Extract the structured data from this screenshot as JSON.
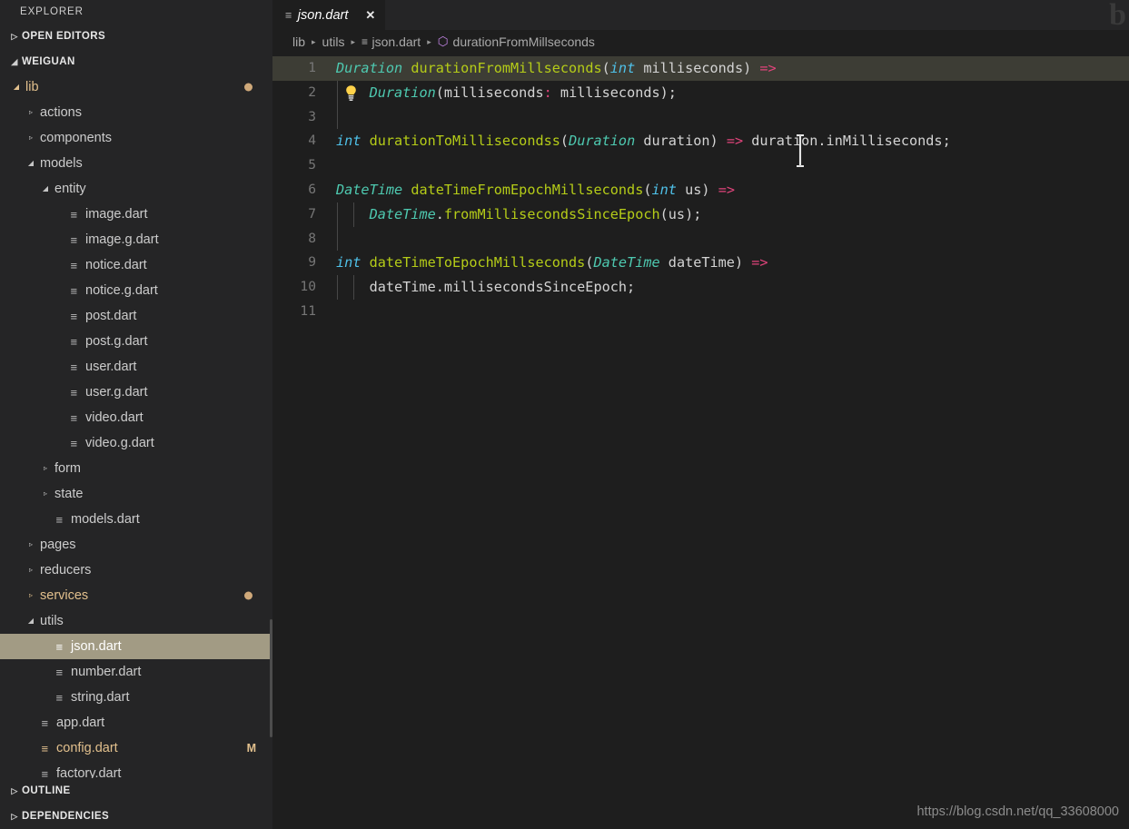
{
  "sidebar": {
    "title": "EXPLORER",
    "panes": [
      {
        "label": "OPEN EDITORS",
        "expanded": false
      },
      {
        "label": "WEIGUAN",
        "expanded": true
      }
    ],
    "bottom_panes": [
      {
        "label": "OUTLINE",
        "expanded": false
      },
      {
        "label": "DEPENDENCIES",
        "expanded": false
      }
    ],
    "tree": [
      {
        "label": "lib",
        "type": "folder",
        "indent": 1,
        "expanded": true,
        "modified": true,
        "dot": true
      },
      {
        "label": "actions",
        "type": "folder",
        "indent": 2,
        "expanded": false
      },
      {
        "label": "components",
        "type": "folder",
        "indent": 2,
        "expanded": false
      },
      {
        "label": "models",
        "type": "folder",
        "indent": 2,
        "expanded": true
      },
      {
        "label": "entity",
        "type": "folder",
        "indent": 3,
        "expanded": true
      },
      {
        "label": "image.dart",
        "type": "file",
        "indent": 4
      },
      {
        "label": "image.g.dart",
        "type": "file",
        "indent": 4
      },
      {
        "label": "notice.dart",
        "type": "file",
        "indent": 4
      },
      {
        "label": "notice.g.dart",
        "type": "file",
        "indent": 4
      },
      {
        "label": "post.dart",
        "type": "file",
        "indent": 4
      },
      {
        "label": "post.g.dart",
        "type": "file",
        "indent": 4
      },
      {
        "label": "user.dart",
        "type": "file",
        "indent": 4
      },
      {
        "label": "user.g.dart",
        "type": "file",
        "indent": 4
      },
      {
        "label": "video.dart",
        "type": "file",
        "indent": 4
      },
      {
        "label": "video.g.dart",
        "type": "file",
        "indent": 4
      },
      {
        "label": "form",
        "type": "folder",
        "indent": 3,
        "expanded": false
      },
      {
        "label": "state",
        "type": "folder",
        "indent": 3,
        "expanded": false
      },
      {
        "label": "models.dart",
        "type": "file",
        "indent": 3
      },
      {
        "label": "pages",
        "type": "folder",
        "indent": 2,
        "expanded": false
      },
      {
        "label": "reducers",
        "type": "folder",
        "indent": 2,
        "expanded": false
      },
      {
        "label": "services",
        "type": "folder",
        "indent": 2,
        "expanded": false,
        "modified": true,
        "dot": true
      },
      {
        "label": "utils",
        "type": "folder",
        "indent": 2,
        "expanded": true
      },
      {
        "label": "json.dart",
        "type": "file",
        "indent": 3,
        "selected": true
      },
      {
        "label": "number.dart",
        "type": "file",
        "indent": 3
      },
      {
        "label": "string.dart",
        "type": "file",
        "indent": 3
      },
      {
        "label": "app.dart",
        "type": "file",
        "indent": 2
      },
      {
        "label": "config.dart",
        "type": "file",
        "indent": 2,
        "modified": true,
        "badge": "M"
      },
      {
        "label": "factory.dart",
        "type": "file",
        "indent": 2
      }
    ]
  },
  "tab": {
    "name": "json.dart",
    "icon": "file-icon",
    "close": "✕",
    "preview": true
  },
  "breadcrumb": [
    {
      "text": "lib",
      "icon": null
    },
    {
      "text": "utils",
      "icon": null
    },
    {
      "text": "json.dart",
      "icon": "file-icon"
    },
    {
      "text": "durationFromMillseconds",
      "icon": "symbol-cube-icon"
    }
  ],
  "editor": {
    "active_line": 1,
    "quickfix_line": 2,
    "quickfix_icon": "lightbulb-icon",
    "lines": [
      {
        "n": 1,
        "active": true,
        "indent_guides": 0,
        "tokens": [
          {
            "t": "Duration",
            "c": "type"
          },
          {
            "t": " ",
            "c": "plain"
          },
          {
            "t": "durationFromMillseconds",
            "c": "fn"
          },
          {
            "t": "(",
            "c": "punct"
          },
          {
            "t": "int",
            "c": "kw"
          },
          {
            "t": " milliseconds",
            "c": "plain"
          },
          {
            "t": ")",
            "c": "punct"
          },
          {
            "t": " ",
            "c": "plain"
          },
          {
            "t": "=>",
            "c": "arrow"
          }
        ]
      },
      {
        "n": 2,
        "active": false,
        "indent_guides": 1,
        "tokens": [
          {
            "t": "    ",
            "c": "plain"
          },
          {
            "t": "Duration",
            "c": "type"
          },
          {
            "t": "(",
            "c": "punct"
          },
          {
            "t": "milliseconds",
            "c": "plain"
          },
          {
            "t": ":",
            "c": "colon"
          },
          {
            "t": " milliseconds",
            "c": "plain"
          },
          {
            "t": ");",
            "c": "punct"
          }
        ]
      },
      {
        "n": 3,
        "active": false,
        "indent_guides": 1,
        "tokens": []
      },
      {
        "n": 4,
        "active": false,
        "indent_guides": 0,
        "tokens": [
          {
            "t": "int",
            "c": "kw"
          },
          {
            "t": " ",
            "c": "plain"
          },
          {
            "t": "durationToMillisecondss",
            "c": "fn"
          },
          {
            "t": "(",
            "c": "punct"
          },
          {
            "t": "Duration",
            "c": "type"
          },
          {
            "t": " duration",
            "c": "plain"
          },
          {
            "t": ")",
            "c": "punct"
          },
          {
            "t": " ",
            "c": "plain"
          },
          {
            "t": "=>",
            "c": "arrow"
          },
          {
            "t": " duration.inMilliseconds;",
            "c": "plain"
          }
        ]
      },
      {
        "n": 5,
        "active": false,
        "indent_guides": 0,
        "tokens": []
      },
      {
        "n": 6,
        "active": false,
        "indent_guides": 0,
        "tokens": [
          {
            "t": "DateTime",
            "c": "type"
          },
          {
            "t": " ",
            "c": "plain"
          },
          {
            "t": "dateTimeFromEpochMillseconds",
            "c": "fn"
          },
          {
            "t": "(",
            "c": "punct"
          },
          {
            "t": "int",
            "c": "kw"
          },
          {
            "t": " us",
            "c": "plain"
          },
          {
            "t": ")",
            "c": "punct"
          },
          {
            "t": " ",
            "c": "plain"
          },
          {
            "t": "=>",
            "c": "arrow"
          }
        ]
      },
      {
        "n": 7,
        "active": false,
        "indent_guides": 2,
        "tokens": [
          {
            "t": "    ",
            "c": "plain"
          },
          {
            "t": "DateTime",
            "c": "type"
          },
          {
            "t": ".",
            "c": "punct"
          },
          {
            "t": "fromMillisecondsSinceEpoch",
            "c": "fn"
          },
          {
            "t": "(us);",
            "c": "plain"
          }
        ]
      },
      {
        "n": 8,
        "active": false,
        "indent_guides": 1,
        "tokens": []
      },
      {
        "n": 9,
        "active": false,
        "indent_guides": 0,
        "tokens": [
          {
            "t": "int",
            "c": "kw"
          },
          {
            "t": " ",
            "c": "plain"
          },
          {
            "t": "dateTimeToEpochMillseconds",
            "c": "fn"
          },
          {
            "t": "(",
            "c": "punct"
          },
          {
            "t": "DateTime",
            "c": "type"
          },
          {
            "t": " dateTime",
            "c": "plain"
          },
          {
            "t": ")",
            "c": "punct"
          },
          {
            "t": " ",
            "c": "plain"
          },
          {
            "t": "=>",
            "c": "arrow"
          }
        ]
      },
      {
        "n": 10,
        "active": false,
        "indent_guides": 2,
        "tokens": [
          {
            "t": "    dateTime.millisecondsSinceEpoch;",
            "c": "plain"
          }
        ]
      },
      {
        "n": 11,
        "active": false,
        "indent_guides": 0,
        "tokens": []
      }
    ]
  },
  "watermarks": {
    "corner_letter": "b",
    "url": "https://blog.csdn.net/qq_33608000"
  },
  "colors": {
    "editor_bg": "#1e1e1e",
    "sidebar_bg": "#252526",
    "active_line": "#3d3d35",
    "selection": "#a29b84",
    "modified": "#e2c08d",
    "type": "#4ec9b0",
    "keyword": "#4fc1e9",
    "function": "#b5cc18",
    "arrow": "#e0447b",
    "symbol_cube": "#c586e8"
  }
}
